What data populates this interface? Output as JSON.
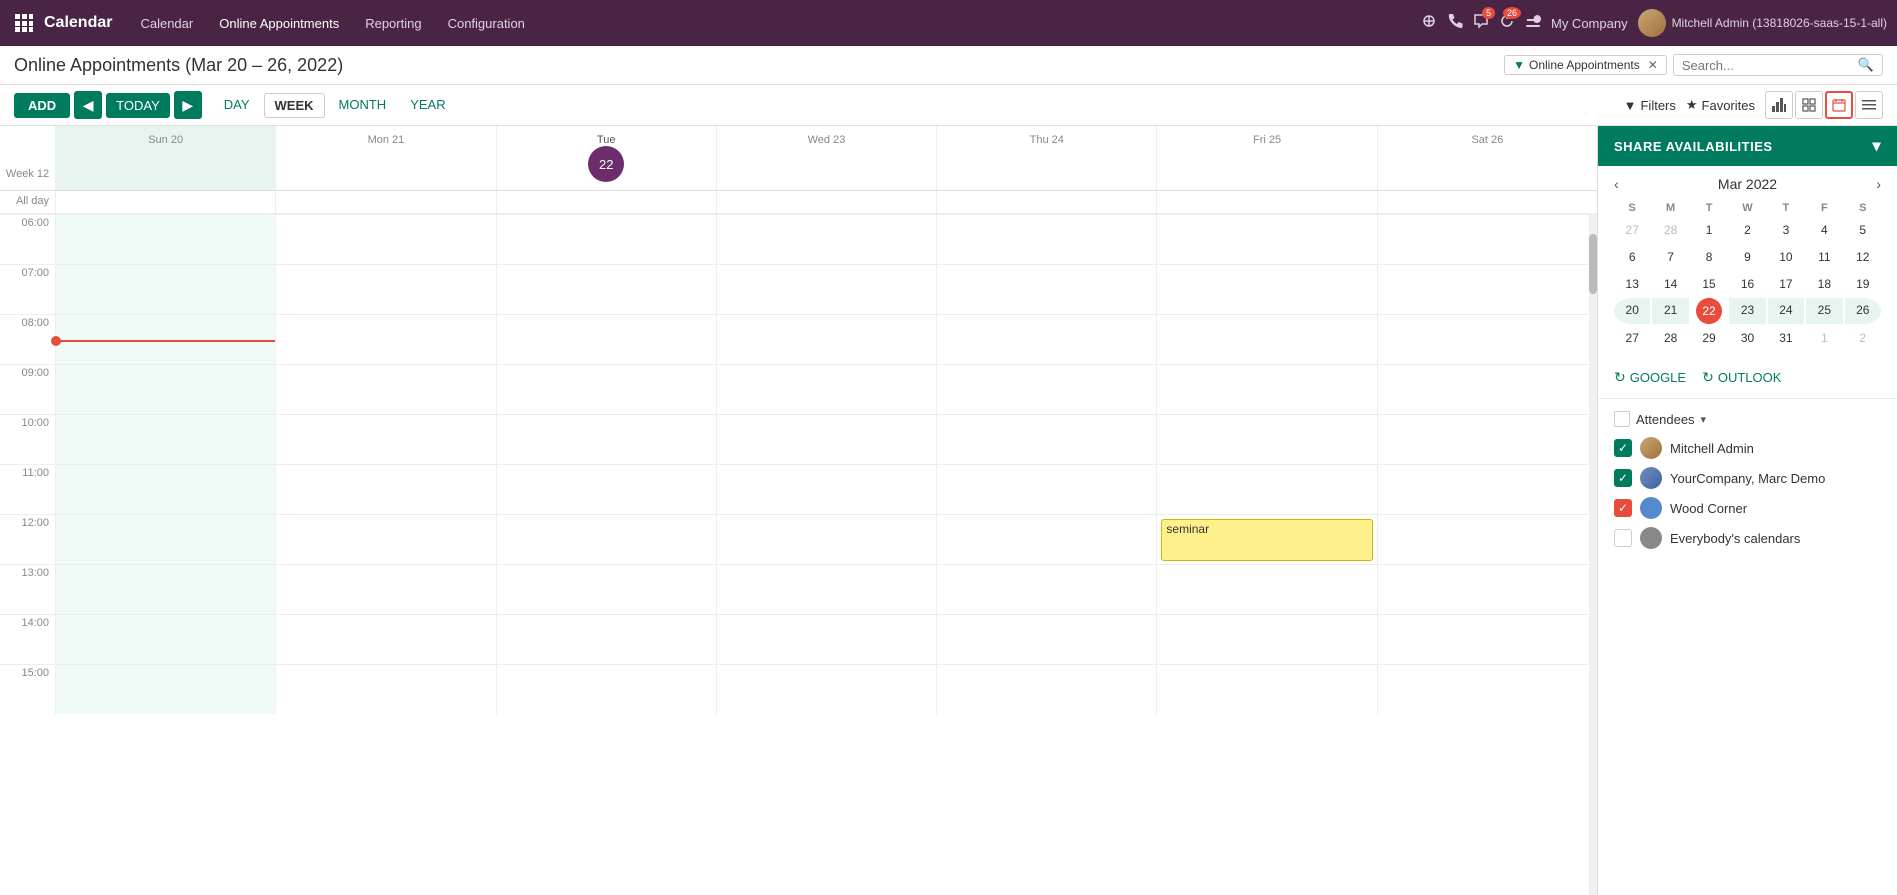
{
  "app": {
    "title": "Calendar",
    "grid_icon": "⊞"
  },
  "nav": {
    "links": [
      "Calendar",
      "Online Appointments",
      "Reporting",
      "Configuration"
    ],
    "active": "Online Appointments"
  },
  "nav_right": {
    "bug_icon": "🐞",
    "phone_icon": "📞",
    "chat_icon": "💬",
    "chat_count": "5",
    "refresh_icon": "↻",
    "refresh_count": "26",
    "wrench_icon": "🔧",
    "company": "My Company",
    "user": "Mitchell Admin (13818026-saas-15-1-all)"
  },
  "page": {
    "title": "Online Appointments (Mar 20 – 26, 2022)"
  },
  "filter": {
    "tag": "Online Appointments",
    "search_placeholder": "Search..."
  },
  "toolbar": {
    "add_label": "ADD",
    "today_label": "TODAY",
    "views": [
      "DAY",
      "WEEK",
      "MONTH",
      "YEAR"
    ],
    "active_view": "WEEK",
    "filters_label": "Filters",
    "favorites_label": "Favorites"
  },
  "calendar": {
    "week_label": "Week 12",
    "days": [
      {
        "name": "Sun",
        "num": "20",
        "today": false,
        "highlighted": true
      },
      {
        "name": "Mon",
        "num": "21",
        "today": false,
        "highlighted": false
      },
      {
        "name": "Tue",
        "num": "22",
        "today": true,
        "highlighted": false
      },
      {
        "name": "Wed",
        "num": "23",
        "today": false,
        "highlighted": false
      },
      {
        "name": "Thu",
        "num": "24",
        "today": false,
        "highlighted": false
      },
      {
        "name": "Fri",
        "num": "25",
        "today": false,
        "highlighted": false
      },
      {
        "name": "Sat",
        "num": "26",
        "today": false,
        "highlighted": false
      }
    ],
    "hours": [
      "06:00",
      "07:00",
      "08:00",
      "09:00",
      "10:00",
      "11:00",
      "12:00",
      "13:00",
      "14:00",
      "15:00"
    ],
    "event": {
      "label": "seminar",
      "col": 5,
      "top_offset": "15px"
    }
  },
  "sidebar": {
    "share_label": "SHARE AVAILABILITIES",
    "mini_cal": {
      "title": "Mar 2022",
      "dows": [
        "S",
        "M",
        "T",
        "W",
        "T",
        "F",
        "S"
      ],
      "weeks": [
        [
          {
            "d": "27",
            "om": true
          },
          {
            "d": "28",
            "om": true
          },
          {
            "d": "1"
          },
          {
            "d": "2"
          },
          {
            "d": "3"
          },
          {
            "d": "4"
          },
          {
            "d": "5"
          }
        ],
        [
          {
            "d": "6"
          },
          {
            "d": "7"
          },
          {
            "d": "8"
          },
          {
            "d": "9"
          },
          {
            "d": "10"
          },
          {
            "d": "11"
          },
          {
            "d": "12"
          }
        ],
        [
          {
            "d": "13"
          },
          {
            "d": "14"
          },
          {
            "d": "15"
          },
          {
            "d": "16"
          },
          {
            "d": "17"
          },
          {
            "d": "18"
          },
          {
            "d": "19"
          }
        ],
        [
          {
            "d": "20",
            "iw": true,
            "ws": true
          },
          {
            "d": "21",
            "iw": true
          },
          {
            "d": "22",
            "today": true
          },
          {
            "d": "23",
            "iw": true
          },
          {
            "d": "24",
            "iw": true
          },
          {
            "d": "25",
            "iw": true
          },
          {
            "d": "26",
            "iw": true,
            "we": true
          }
        ],
        [
          {
            "d": "27"
          },
          {
            "d": "28"
          },
          {
            "d": "29"
          },
          {
            "d": "30"
          },
          {
            "d": "31"
          },
          {
            "d": "1",
            "om": true
          },
          {
            "d": "2",
            "om": true
          }
        ]
      ]
    },
    "sync_google": "GOOGLE",
    "sync_outlook": "OUTLOOK",
    "attendees_label": "Attendees",
    "attendees": [
      {
        "name": "Mitchell Admin",
        "checked": "teal",
        "avatar": "mitchell"
      },
      {
        "name": "YourCompany, Marc Demo",
        "checked": "teal",
        "avatar": "marc"
      },
      {
        "name": "Wood Corner",
        "checked": "red",
        "avatar": "wood"
      },
      {
        "name": "Everybody's calendars",
        "checked": "none",
        "avatar": "everybody"
      }
    ]
  }
}
